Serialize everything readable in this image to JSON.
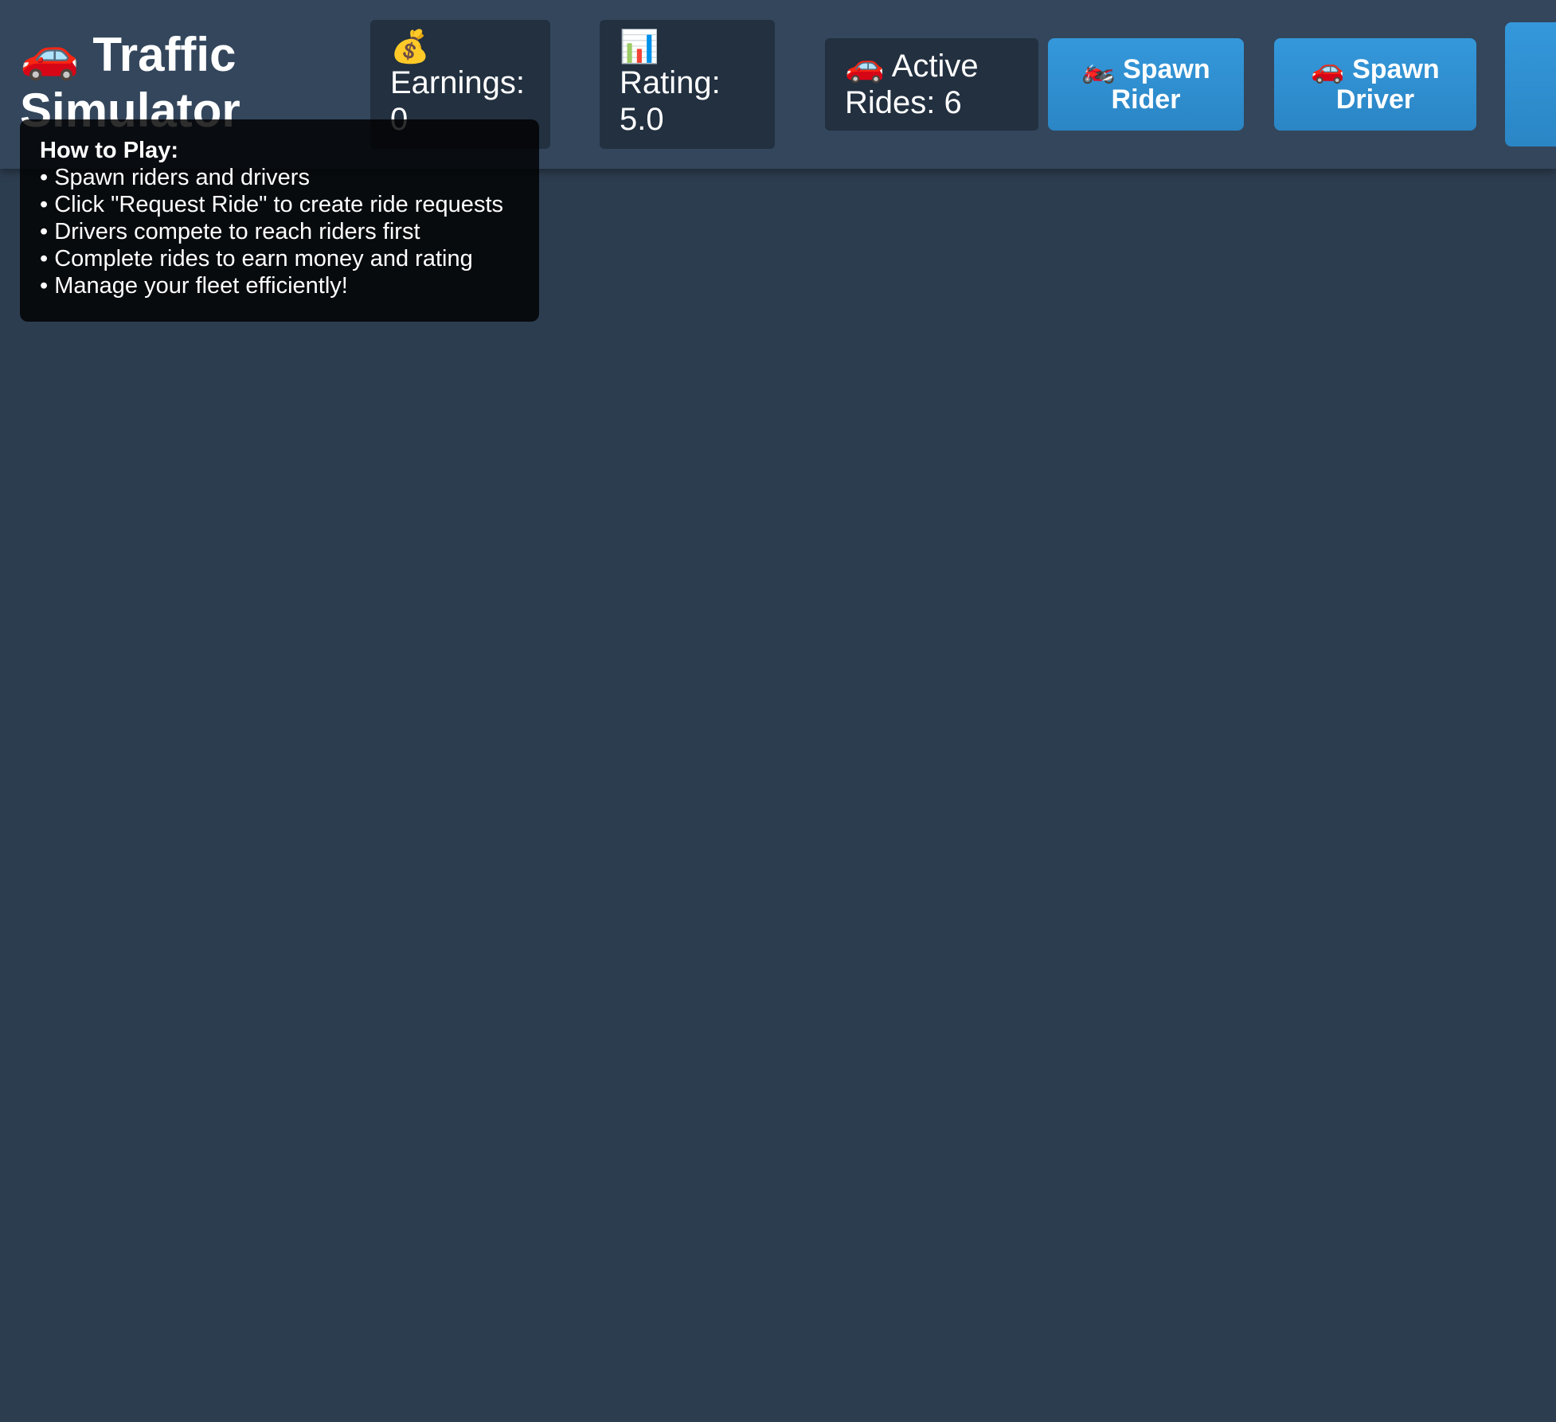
{
  "header": {
    "title_icon": "🚗",
    "title": "Traffic Simulator",
    "stats": {
      "earnings": {
        "icon": "💰",
        "label": "Earnings: 0"
      },
      "rating": {
        "icon": "📊",
        "label": "Rating: 5.0"
      },
      "active_rides": {
        "icon": "🚗",
        "label": "Active Rides: 6"
      }
    },
    "buttons": {
      "spawn_rider": {
        "icon": "🏍️",
        "label": "Spawn Rider"
      },
      "spawn_driver": {
        "icon": "🚗",
        "label": "Spawn Driver"
      }
    },
    "colors": {
      "header_bg": "#33465c",
      "page_bg": "#2d3d50",
      "stat_bg": "#223040",
      "button_accent": "#3498db"
    }
  },
  "help": {
    "title": "How to Play:",
    "items": [
      "• Spawn riders and drivers",
      "• Click \"Request Ride\" to create ride requests",
      "• Drivers compete to reach riders first",
      "• Complete rides to earn money and rating",
      "• Manage your fleet efficiently!"
    ]
  }
}
